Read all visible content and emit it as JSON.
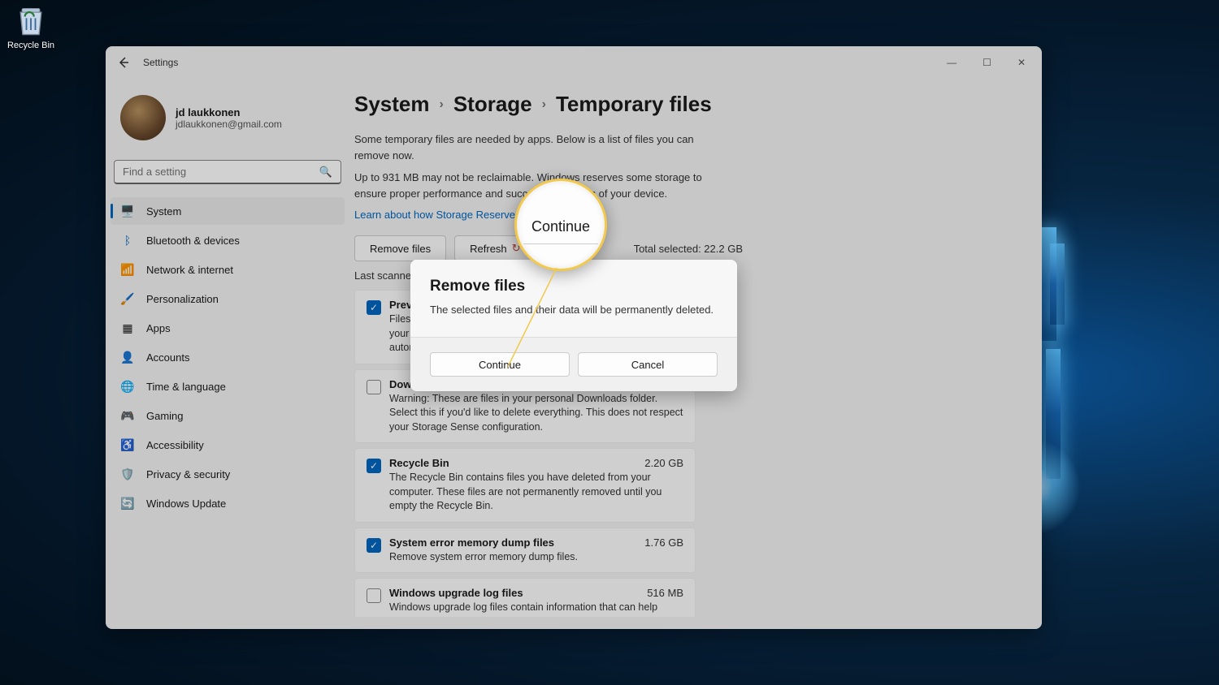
{
  "desktop": {
    "recycle_label": "Recycle Bin"
  },
  "window": {
    "title": "Settings",
    "back": "←"
  },
  "profile": {
    "name": "jd laukkonen",
    "email": "jdlaukkonen@gmail.com"
  },
  "search": {
    "placeholder": "Find a setting"
  },
  "nav": [
    {
      "icon": "🖥️",
      "label": "System"
    },
    {
      "icon": "ᛒ",
      "label": "Bluetooth & devices"
    },
    {
      "icon": "📶",
      "label": "Network & internet"
    },
    {
      "icon": "🖌️",
      "label": "Personalization"
    },
    {
      "icon": "▦",
      "label": "Apps"
    },
    {
      "icon": "👤",
      "label": "Accounts"
    },
    {
      "icon": "🌐",
      "label": "Time & language"
    },
    {
      "icon": "🎮",
      "label": "Gaming"
    },
    {
      "icon": "♿",
      "label": "Accessibility"
    },
    {
      "icon": "🛡️",
      "label": "Privacy & security"
    },
    {
      "icon": "🔄",
      "label": "Windows Update"
    }
  ],
  "breadcrumb": {
    "a": "System",
    "b": "Storage",
    "c": "Temporary files",
    "sep": "›"
  },
  "intro": {
    "p1": "Some temporary files are needed by apps. Below is a list of files you can remove now.",
    "p2": "Up to 931 MB may not be reclaimable. Windows reserves some storage to ensure proper performance and successful updates of your device.",
    "link": "Learn about how Storage Reserve works"
  },
  "actions": {
    "remove": "Remove files",
    "refresh": "Refresh",
    "total": "Total selected: 22.2 GB"
  },
  "scan": "Last scanned",
  "files": {
    "f1": {
      "title": "Previous",
      "size": "",
      "desc": "Files from a previous installation of Windows. This may contain your Windows.old folder and other folders. These will be deleted automatically after the previous version…"
    },
    "f2": {
      "title": "Downloads",
      "size": "",
      "desc": "Warning: These are files in your personal Downloads folder. Select this if you'd like to delete everything. This does not respect your Storage Sense configuration."
    },
    "f3": {
      "title": "Recycle Bin",
      "size": "2.20 GB",
      "desc": "The Recycle Bin contains files you have deleted from your computer. These files are not permanently removed until you empty the Recycle Bin."
    },
    "f4": {
      "title": "System error memory dump files",
      "size": "1.76 GB",
      "desc": "Remove system error memory dump files."
    },
    "f5": {
      "title": "Windows upgrade log files",
      "size": "516 MB",
      "desc": "Windows upgrade log files contain information that can help identify and troubleshoot problems that occur during Windows"
    }
  },
  "dialog": {
    "title": "Remove files",
    "msg": "The selected files and their data will be permanently deleted.",
    "continue": "Continue",
    "cancel": "Cancel"
  },
  "magnifier": "Continue"
}
